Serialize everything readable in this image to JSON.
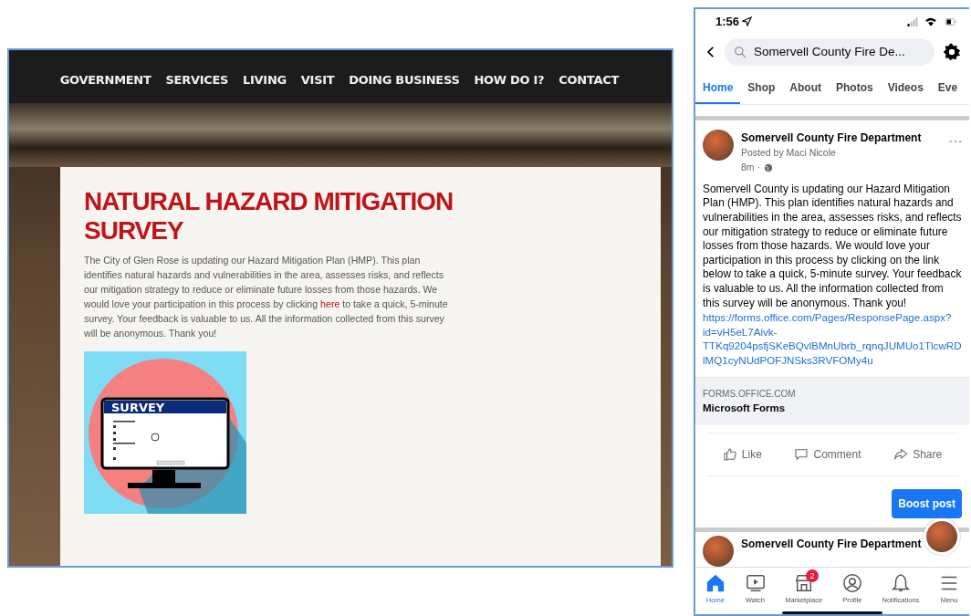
{
  "website": {
    "nav": [
      {
        "label": "GOVERNMENT"
      },
      {
        "label": "SERVICES"
      },
      {
        "label": "LIVING"
      },
      {
        "label": "VISIT"
      },
      {
        "label": "DOING BUSINESS"
      },
      {
        "label": "HOW DO I?"
      },
      {
        "label": "CONTACT"
      }
    ],
    "title": "NATURAL HAZARD MITIGATION SURVEY",
    "intro": {
      "before": "The City of Glen Rose is updating our Hazard Mitigation Plan (HMP). This plan identifies natural hazards and vulnerabilities in the area, assesses risks, and reflects our mitigation strategy to reduce or eliminate future losses from those hazards. We would love your participation in this process by clicking ",
      "link": "here",
      "after": " to take a quick, 5-minute survey. Your feedback is valuable to us. All the information collected from this survey will be anonymous. Thank you!"
    },
    "image": {
      "caption": "SURVEY"
    }
  },
  "phone": {
    "status": {
      "time": "1:56"
    },
    "search": {
      "value": "Somervell County Fire De..."
    },
    "tabs": [
      {
        "label": "Home",
        "selected": true
      },
      {
        "label": "Shop",
        "selected": false
      },
      {
        "label": "About",
        "selected": false
      },
      {
        "label": "Photos",
        "selected": false
      },
      {
        "label": "Videos",
        "selected": false
      },
      {
        "label": "Eve",
        "selected": false
      }
    ],
    "post": {
      "author": "Somervell County Fire Department",
      "byline": "Posted by Maci Nicole",
      "time": "8m ·",
      "body": "Somervell County is updating our Hazard Mitigation Plan (HMP). This plan identifies natural hazards and vulnerabilities in the area, assesses risks, and reflects our mitigation strategy to reduce or eliminate future losses from those hazards. We would love your participation in this process by clicking on the link below to take a quick, 5-minute survey. Your feedback is valuable to us. All the information collected from this survey will be anonymous. Thank you!",
      "link": "https://forms.office.com/Pages/ResponsePage.aspx?id=vH5eL7Aivk-TTKq9204psfjSKeBQvlBMnUbrb_rqnqJUMUo1TlcwRDlMQ1cyNUdPOFJNSks3RVFOMy4u",
      "preview": {
        "domain": "FORMS.OFFICE.COM",
        "title": "Microsoft Forms"
      },
      "actions": [
        {
          "label": "Like",
          "kind": "like"
        },
        {
          "label": "Comment",
          "kind": "comment"
        },
        {
          "label": "Share",
          "kind": "share"
        }
      ],
      "boost": "Boost post"
    },
    "next_post": {
      "author": "Somervell County Fire Department"
    },
    "bottom_nav": [
      {
        "label": "Home",
        "kind": "home",
        "selected": true
      },
      {
        "label": "Watch",
        "kind": "watch",
        "selected": false
      },
      {
        "label": "Marketplace",
        "kind": "marketplace",
        "selected": false,
        "badge": "2"
      },
      {
        "label": "Profile",
        "kind": "profile",
        "selected": false
      },
      {
        "label": "Notifications",
        "kind": "notifications",
        "selected": false
      },
      {
        "label": "Menu",
        "kind": "menu",
        "selected": false
      }
    ]
  }
}
